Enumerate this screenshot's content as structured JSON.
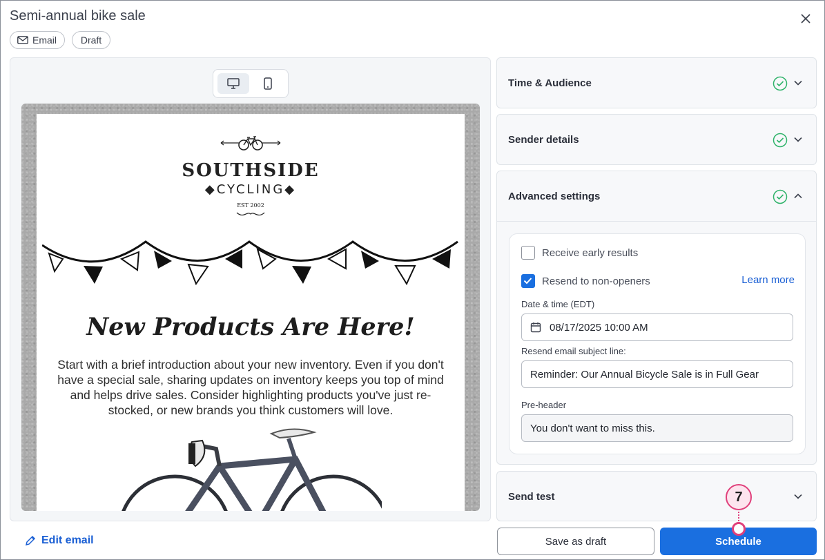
{
  "header": {
    "title": "Semi-annual bike sale",
    "chips": {
      "email": "Email",
      "draft": "Draft"
    }
  },
  "preview": {
    "logo": {
      "line1": "SOUTHSIDE",
      "line2": "CYCLING",
      "est": "EST 2002"
    },
    "headline": "New Products Are Here!",
    "body": "Start with a brief introduction about your new inventory. Even if you don't have a special sale, sharing updates on inventory keeps you top of mind and helps drive sales. Consider highlighting products you've just re-stocked, or new brands you think customers will love.",
    "edit_link": "Edit email"
  },
  "panels": {
    "time_audience": "Time & Audience",
    "sender_details": "Sender details",
    "advanced_settings": "Advanced settings",
    "send_test": "Send test"
  },
  "advanced": {
    "receive_early_results": "Receive early results",
    "receive_early_checked": false,
    "resend_non_openers": "Resend to non-openers",
    "resend_checked": true,
    "learn_more": "Learn more",
    "date_label": "Date & time (EDT)",
    "date_value": "08/17/2025 10:00 AM",
    "subject_label": "Resend email subject line:",
    "subject_value": "Reminder: Our Annual Bicycle Sale is in Full Gear",
    "preheader_label": "Pre-header",
    "preheader_value": "You don't want to miss this."
  },
  "footer": {
    "save_draft": "Save as draft",
    "schedule": "Schedule"
  },
  "annotation": {
    "step": "7"
  },
  "colors": {
    "accent": "#1a6fe0",
    "success": "#2fb36a",
    "annotation": "#e0407b"
  }
}
